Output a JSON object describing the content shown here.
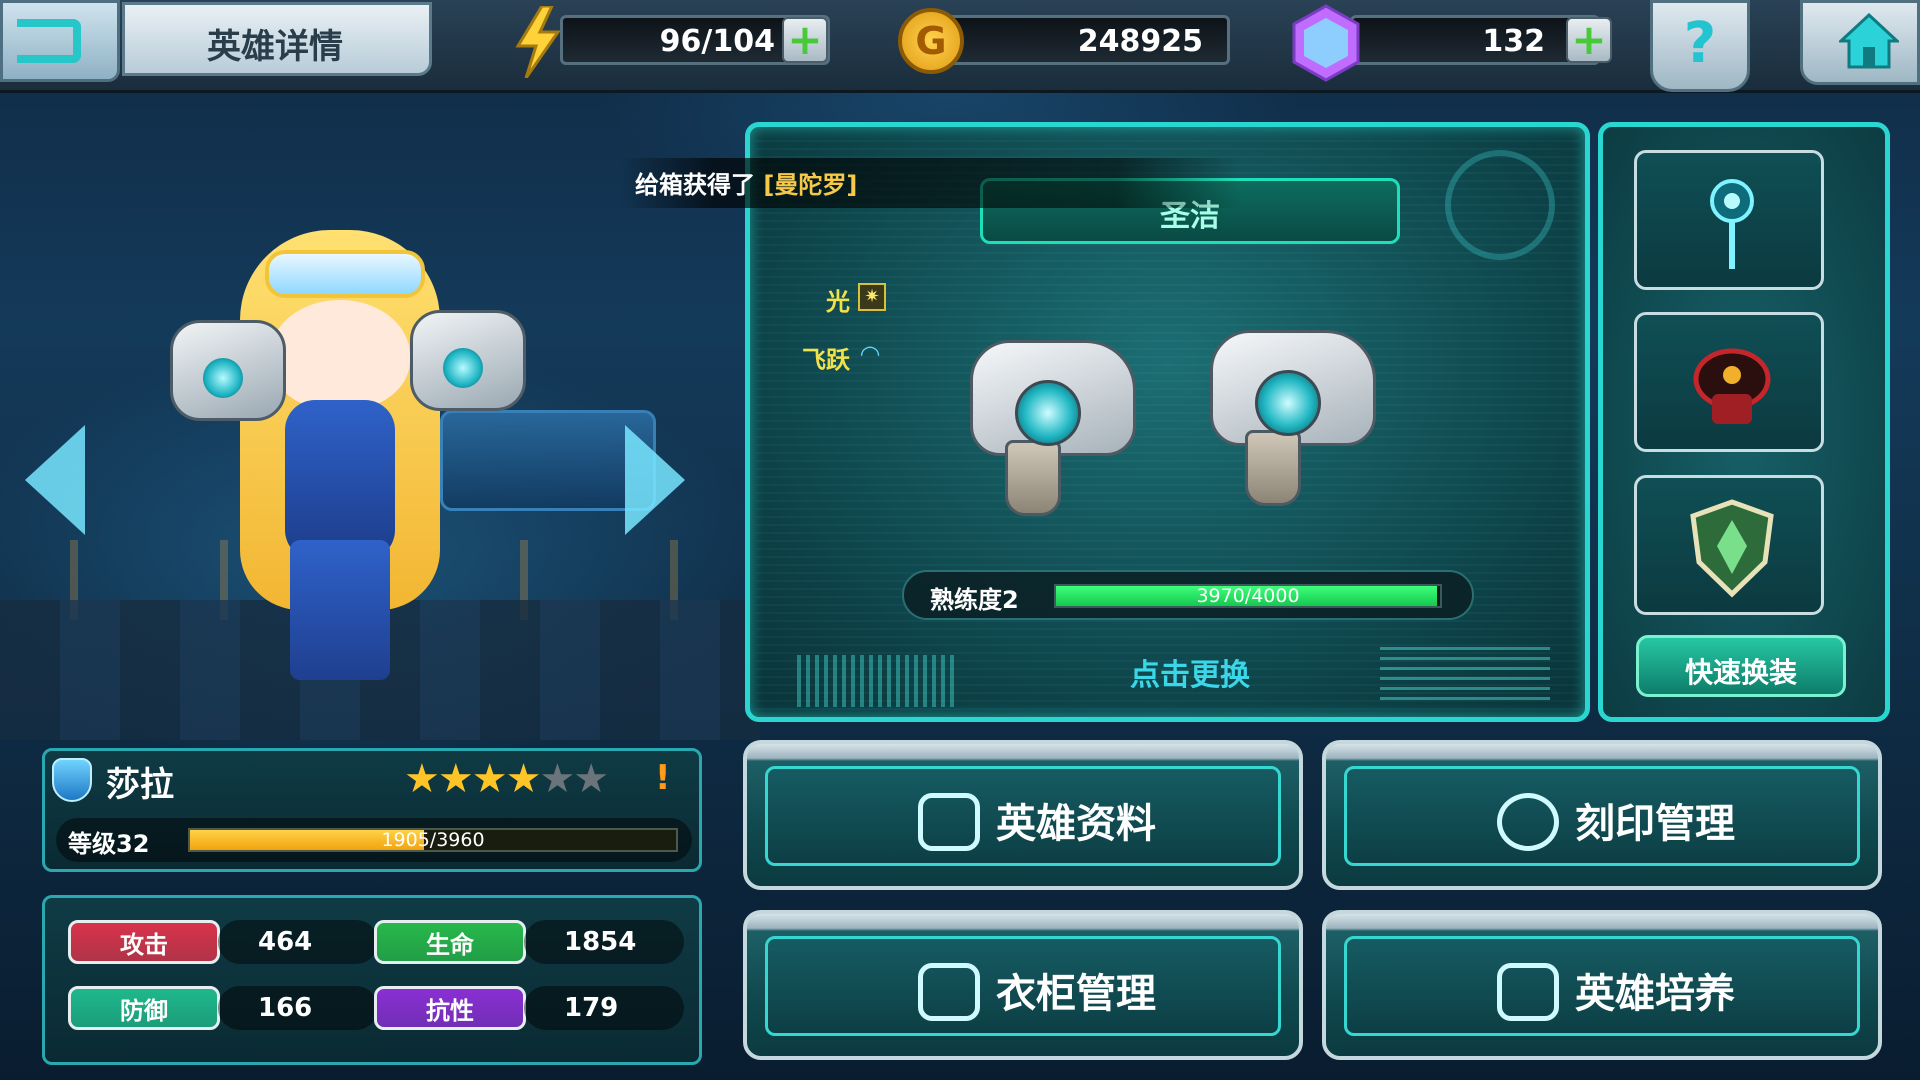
{
  "header": {
    "title": "英雄详情",
    "energy": "96/104",
    "gold": "248925",
    "gems": "132",
    "gold_icon_letter": "G",
    "help_label": "?"
  },
  "notice": {
    "prefix": "给箱获得了",
    "item": "[曼陀罗]"
  },
  "weapon": {
    "name": "圣洁",
    "attributes": [
      {
        "label": "光",
        "icon": "sun-element-icon"
      },
      {
        "label": "飞跃",
        "icon": "wing-element-icon"
      }
    ],
    "proficiency_label": "熟练度2",
    "proficiency_text": "3970/4000",
    "proficiency_progress": 0.9925,
    "change_label": "点击更换"
  },
  "equipment_slots": [
    {
      "name": "staff-accessory-icon"
    },
    {
      "name": "armor-accessory-icon"
    },
    {
      "name": "shield-emblem-icon"
    }
  ],
  "quick_equip_label": "快速换装",
  "hero": {
    "name": "莎拉",
    "stars_filled": 4,
    "stars_total": 6,
    "warning": "!",
    "level_label": "等级32",
    "exp_text": "1905/3960",
    "exp_progress": 0.481
  },
  "stats": [
    {
      "label": "攻击",
      "value": "464",
      "color": "#d8334a"
    },
    {
      "label": "生命",
      "value": "1854",
      "color": "#27b84a"
    },
    {
      "label": "防御",
      "value": "166",
      "color": "#1fb88b"
    },
    {
      "label": "抗性",
      "value": "179",
      "color": "#8a2fd4"
    }
  ],
  "actions": {
    "hero_info": "英雄资料",
    "imprint": "刻印管理",
    "wardrobe": "衣柜管理",
    "training": "英雄培养"
  },
  "colors": {
    "accent": "#2ad6d0",
    "gold": "#f7c948",
    "energy_fill": "#15c84e",
    "exp_fill": "#f2a30f"
  }
}
